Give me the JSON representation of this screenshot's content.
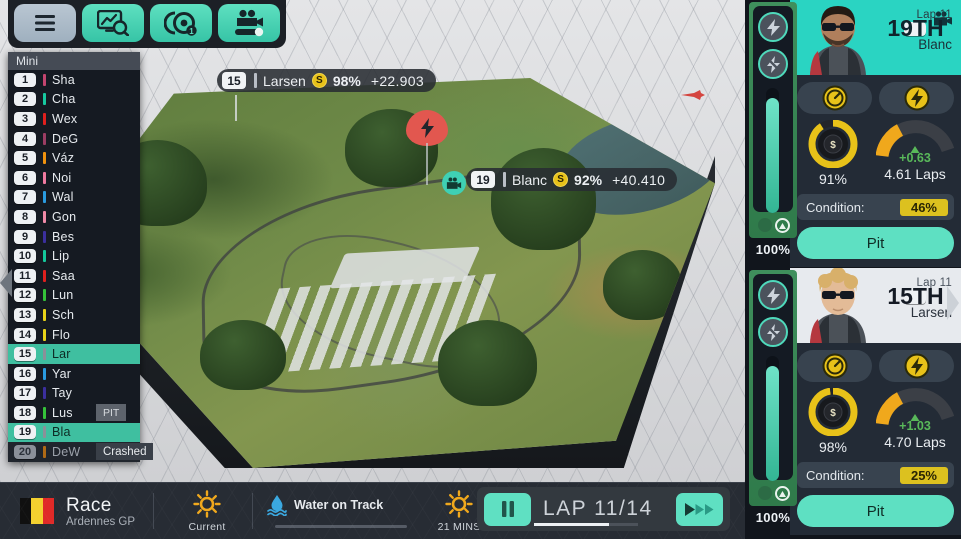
{
  "toolbar": {
    "buttons": [
      {
        "name": "menu-button",
        "icon": "hamburger-menu-icon",
        "style": "grey"
      },
      {
        "name": "telemetry-button",
        "icon": "chart-search-icon",
        "style": "teal"
      },
      {
        "name": "strategy-button",
        "icon": "tyre-strategy-icon",
        "style": "teal",
        "badge": "1"
      },
      {
        "name": "camera-button",
        "icon": "camera-slider-icon",
        "style": "teal"
      }
    ]
  },
  "leaderboard": {
    "title": "Mini",
    "rows": [
      {
        "pos": "1",
        "name": "Sha",
        "color": "#c4456f",
        "state": "normal",
        "tag": ""
      },
      {
        "pos": "2",
        "name": "Cha",
        "color": "#17c9a0",
        "state": "normal",
        "tag": ""
      },
      {
        "pos": "3",
        "name": "Wex",
        "color": "#e0201e",
        "state": "normal",
        "tag": ""
      },
      {
        "pos": "4",
        "name": "DeG",
        "color": "#9b3d63",
        "state": "normal",
        "tag": ""
      },
      {
        "pos": "5",
        "name": "Váz",
        "color": "#f0920e",
        "state": "normal",
        "tag": ""
      },
      {
        "pos": "6",
        "name": "Noi",
        "color": "#f07aa0",
        "state": "normal",
        "tag": ""
      },
      {
        "pos": "7",
        "name": "Wal",
        "color": "#2a9be0",
        "state": "normal",
        "tag": ""
      },
      {
        "pos": "8",
        "name": "Gon",
        "color": "#f08aa8",
        "state": "normal",
        "tag": ""
      },
      {
        "pos": "9",
        "name": "Bes",
        "color": "#3b2f9e",
        "state": "normal",
        "tag": ""
      },
      {
        "pos": "10",
        "name": "Lip",
        "color": "#14c79c",
        "state": "normal",
        "tag": ""
      },
      {
        "pos": "11",
        "name": "Saa",
        "color": "#e0201e",
        "state": "normal",
        "tag": ""
      },
      {
        "pos": "12",
        "name": "Lun",
        "color": "#35c23a",
        "state": "normal",
        "tag": ""
      },
      {
        "pos": "13",
        "name": "Sch",
        "color": "#e8d319",
        "state": "normal",
        "tag": ""
      },
      {
        "pos": "14",
        "name": "Flo",
        "color": "#e8d319",
        "state": "normal",
        "tag": ""
      },
      {
        "pos": "15",
        "name": "Lar",
        "color": "#8b9099",
        "state": "highlight",
        "tag": ""
      },
      {
        "pos": "16",
        "name": "Yar",
        "color": "#2a9be0",
        "state": "normal",
        "tag": ""
      },
      {
        "pos": "17",
        "name": "Tay",
        "color": "#3b2f9e",
        "state": "normal",
        "tag": ""
      },
      {
        "pos": "18",
        "name": "Lus",
        "color": "#35c23a",
        "state": "normal",
        "tag": "PIT"
      },
      {
        "pos": "19",
        "name": "Bla",
        "color": "#8b9099",
        "state": "highlight",
        "tag": ""
      },
      {
        "pos": "20",
        "name": "DeW",
        "color": "#b06a16",
        "state": "retired",
        "tag": "Crashed"
      }
    ]
  },
  "track_labels": [
    {
      "pos": "15",
      "name": "Larsen",
      "tyre": "S",
      "pct": "98%",
      "gap": "+22.903",
      "camera": false
    },
    {
      "pos": "19",
      "name": "Blanc",
      "tyre": "S",
      "pct": "92%",
      "gap": "+40.410",
      "camera": true
    }
  ],
  "energy_panels": [
    {
      "name": "energy-panel-blanc",
      "percent": "100%",
      "fill": 92,
      "buttons": [
        "overtake-boost-icon",
        "defend-boost-icon"
      ]
    },
    {
      "name": "energy-panel-larsen",
      "percent": "100%",
      "fill": 92,
      "buttons": [
        "overtake-boost-icon",
        "defend-boost-icon"
      ]
    }
  ],
  "driver_cards": [
    {
      "lap_label": "Lap 11",
      "position": "19TH",
      "driver": "Blanc",
      "header_bg": "#2ad4c2",
      "pace_icon": "pace-dial-icon",
      "boost_icon": "energy-bolt-icon",
      "tyre_label": "91%",
      "tyre_ring_pct": 91,
      "fuel_label": "4.61 Laps",
      "fuel_delta": "+0.63",
      "fuel_gauge_pct": 30,
      "condition_label": "Condition:",
      "condition_value": "46%",
      "pit_label": "Pit",
      "camera_icon": "camera-icon",
      "hair": "#2a2018",
      "skin": "#b07f5c",
      "beard": true
    },
    {
      "lap_label": "Lap 11",
      "position": "15TH",
      "driver": "Larsen",
      "header_bg": "#e7eaee",
      "pace_icon": "pace-dial-icon",
      "boost_icon": "energy-bolt-icon",
      "tyre_label": "98%",
      "tyre_ring_pct": 98,
      "fuel_label": "4.70 Laps",
      "fuel_delta": "+1.03",
      "fuel_gauge_pct": 30,
      "condition_label": "Condition:",
      "condition_value": "25%",
      "pit_label": "Pit",
      "camera_icon": "",
      "hair": "#d8b06a",
      "skin": "#e3bb97",
      "beard": false
    }
  ],
  "bottom_bar": {
    "flag_colors": [
      "#101010",
      "#f3d02f",
      "#e02a28"
    ],
    "session_type": "Race",
    "session_name": "Ardennes GP",
    "weather_current_label": "Current",
    "weather_current_icon": "sun-icon",
    "weather_event_label": "Water on Track",
    "weather_event_icon": "water-droplet-icon",
    "weather_next_label": "21 MINS",
    "weather_next_icon": "sun-icon",
    "pause_icon": "pause-icon",
    "lap_text": "LAP 11/14",
    "lap_progress": 72,
    "fastforward_icon": "fast-forward-icon"
  },
  "colors": {
    "accent_teal": "#5ee0c2",
    "highlight_row": "#3fbfa0",
    "warn_yellow": "#dcc11f",
    "delta_green": "#59b85a",
    "panel_dark": "#232b36"
  }
}
